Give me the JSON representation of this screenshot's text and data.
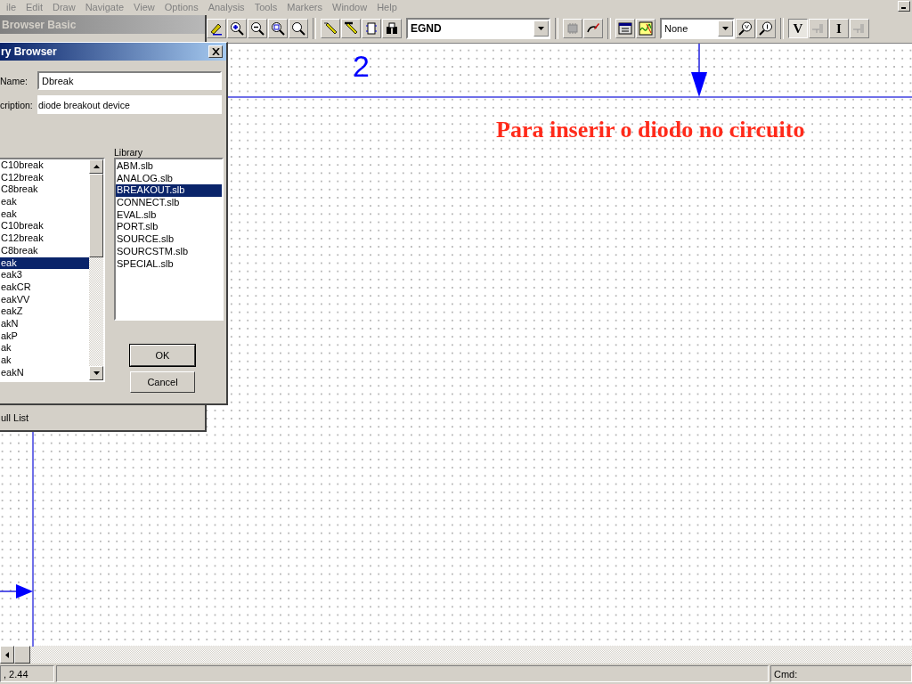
{
  "menu": [
    "ile",
    "Edit",
    "Draw",
    "Navigate",
    "View",
    "Options",
    "Analysis",
    "Tools",
    "Markers",
    "Window",
    "Help"
  ],
  "toolbar": {
    "part_combo": "EGND",
    "marker_combo": "None",
    "letter_buttons": [
      {
        "label": "V",
        "pressed": true
      },
      {
        "label": "I",
        "pressed": false
      }
    ]
  },
  "back_window": {
    "title": "Browser Basic",
    "footer": "ull List"
  },
  "part_browser": {
    "title": "ry Browser",
    "name_label": "Name:",
    "name_value": "Dbreak",
    "description_label": "cription:",
    "description_value": "diode breakout device",
    "parts": [
      {
        "label": "C10break",
        "selected": false
      },
      {
        "label": "C12break",
        "selected": false
      },
      {
        "label": "C8break",
        "selected": false
      },
      {
        "label": "eak",
        "selected": false
      },
      {
        "label": "eak",
        "selected": false
      },
      {
        "label": "C10break",
        "selected": false
      },
      {
        "label": "C12break",
        "selected": false
      },
      {
        "label": "C8break",
        "selected": false
      },
      {
        "label": "eak",
        "selected": true
      },
      {
        "label": "eak3",
        "selected": false
      },
      {
        "label": "eakCR",
        "selected": false
      },
      {
        "label": "eakVV",
        "selected": false
      },
      {
        "label": "eakZ",
        "selected": false
      },
      {
        "label": "akN",
        "selected": false
      },
      {
        "label": "akP",
        "selected": false
      },
      {
        "label": "ak",
        "selected": false
      },
      {
        "label": "ak",
        "selected": false
      },
      {
        "label": "eakN",
        "selected": false
      }
    ],
    "library_label": "Library",
    "libraries": [
      {
        "label": "ABM.slb",
        "selected": false
      },
      {
        "label": "ANALOG.slb",
        "selected": false
      },
      {
        "label": "BREAKOUT.slb",
        "selected": true
      },
      {
        "label": "CONNECT.slb",
        "selected": false
      },
      {
        "label": "EVAL.slb",
        "selected": false
      },
      {
        "label": "PORT.slb",
        "selected": false
      },
      {
        "label": "SOURCE.slb",
        "selected": false
      },
      {
        "label": "SOURCSTM.slb",
        "selected": false
      },
      {
        "label": "SPECIAL.slb",
        "selected": false
      }
    ],
    "buttons": [
      "OK",
      "Cancel"
    ]
  },
  "canvas": {
    "page_number": "2",
    "annotation": "Para inserir o diodo no circuito"
  },
  "status_bar": {
    "coordinates": ", 2.44",
    "command_label": "Cmd:"
  }
}
